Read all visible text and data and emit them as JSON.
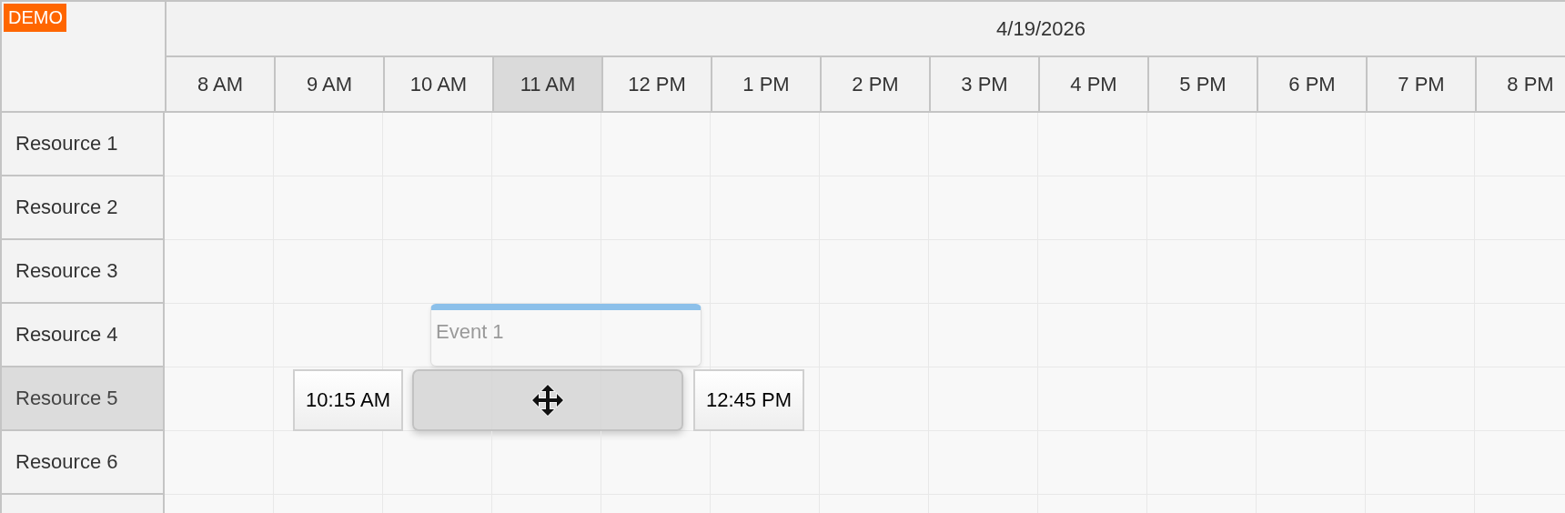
{
  "badge": "DEMO",
  "date_header": "4/19/2026",
  "columns": [
    {
      "label": "8 AM",
      "selected": false
    },
    {
      "label": "9 AM",
      "selected": false
    },
    {
      "label": "10 AM",
      "selected": false
    },
    {
      "label": "11 AM",
      "selected": true
    },
    {
      "label": "12 PM",
      "selected": false
    },
    {
      "label": "1 PM",
      "selected": false
    },
    {
      "label": "2 PM",
      "selected": false
    },
    {
      "label": "3 PM",
      "selected": false
    },
    {
      "label": "4 PM",
      "selected": false
    },
    {
      "label": "5 PM",
      "selected": false
    },
    {
      "label": "6 PM",
      "selected": false
    },
    {
      "label": "7 PM",
      "selected": false
    },
    {
      "label": "8 PM",
      "selected": false
    }
  ],
  "rows": [
    {
      "name": "Resource 1",
      "selected": false
    },
    {
      "name": "Resource 2",
      "selected": false
    },
    {
      "name": "Resource 3",
      "selected": false
    },
    {
      "name": "Resource 4",
      "selected": false,
      "events": [
        {
          "title": "Event 1"
        }
      ]
    },
    {
      "name": "Resource 5",
      "selected": true,
      "drag": {
        "start": "10:15 AM",
        "end": "12:45 PM"
      }
    },
    {
      "name": "Resource 6",
      "selected": false
    }
  ]
}
